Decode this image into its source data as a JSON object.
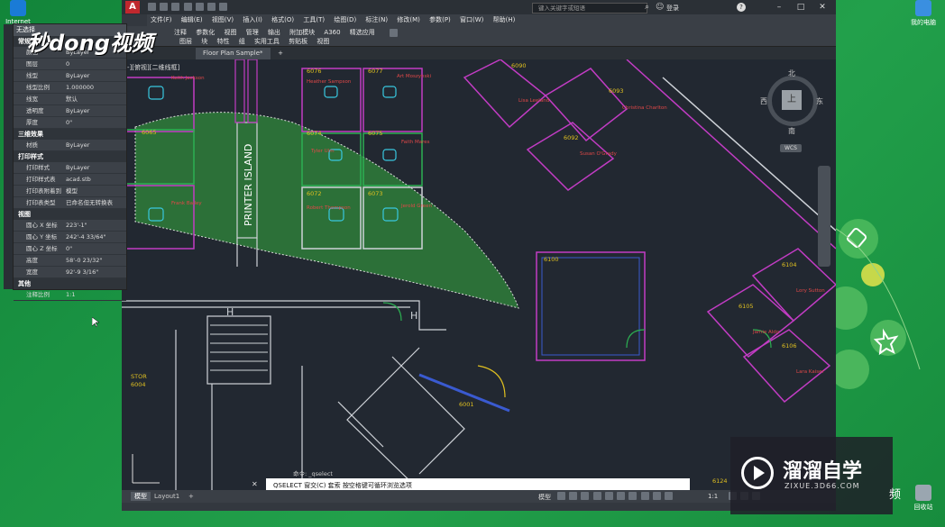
{
  "desktop": {
    "icons": [
      {
        "label": "Internet",
        "color": "#1a7bd6"
      },
      {
        "label": "我的电脑",
        "color": "#3a8fe0"
      },
      {
        "label": "回收站",
        "color": "#9aa6b0"
      }
    ]
  },
  "watermark": {
    "logo_text": "秒dong视频",
    "brand_cn": "溜溜自学",
    "brand_url": "ZIXUE.3D66.COM",
    "brand_fragment": "频"
  },
  "titlebar": {
    "search_placeholder": "键入关键字或短语",
    "login": "登录",
    "help": "?"
  },
  "menu": {
    "items": [
      "文件(F)",
      "编辑(E)",
      "视图(V)",
      "插入(I)",
      "格式(O)",
      "工具(T)",
      "绘图(D)",
      "标注(N)",
      "修改(M)",
      "参数(P)",
      "窗口(W)",
      "帮助(H)"
    ]
  },
  "ribbon": {
    "row1": [
      "注释",
      "参数化",
      "视图",
      "管理",
      "输出",
      "附加模块",
      "A360",
      "精选应用"
    ],
    "row2": [
      "图层",
      "块",
      "特性",
      "组",
      "实用工具",
      "剪贴板",
      "视图"
    ]
  },
  "tabs": {
    "doc": "Floor Plan Sample*",
    "add": "+"
  },
  "viewport": {
    "label": "-][俯视][二维线框]"
  },
  "properties": {
    "selection": "无选择",
    "sections": [
      {
        "title": "常规",
        "rows": [
          [
            "颜色",
            "ByLayer"
          ],
          [
            "图层",
            "0"
          ],
          [
            "线型",
            "ByLayer"
          ],
          [
            "线型比例",
            "1.000000"
          ],
          [
            "线宽",
            "默认"
          ],
          [
            "透明度",
            "ByLayer"
          ],
          [
            "厚度",
            "0\""
          ]
        ]
      },
      {
        "title": "三维效果",
        "rows": [
          [
            "材质",
            "ByLayer"
          ]
        ]
      },
      {
        "title": "打印样式",
        "rows": [
          [
            "打印样式",
            "ByLayer"
          ],
          [
            "打印样式表",
            "acad.stb"
          ],
          [
            "打印表附着到",
            "模型"
          ],
          [
            "打印表类型",
            "已命名但无转换表"
          ]
        ]
      },
      {
        "title": "视图",
        "rows": [
          [
            "圆心 X 坐标",
            "223'-1\""
          ],
          [
            "圆心 Y 坐标",
            "242'-4 33/64\""
          ],
          [
            "圆心 Z 坐标",
            "0\""
          ],
          [
            "高度",
            "58'-0 23/32\""
          ],
          [
            "宽度",
            "92'-9 3/16\""
          ]
        ]
      },
      {
        "title": "其他",
        "rows": [
          [
            "注释比例",
            "1:1"
          ]
        ]
      }
    ]
  },
  "viewcube": {
    "north": "北",
    "south": "南",
    "east": "东",
    "west": "西",
    "top": "上",
    "wcs": "WCS"
  },
  "drawing": {
    "printer_island": "PRINTER ISLAND",
    "rooms": [
      "6076",
      "6077",
      "6074",
      "6075",
      "6072",
      "6073",
      "6090",
      "6093",
      "6092",
      "6100",
      "6104",
      "6105",
      "6106",
      "6001",
      "6004",
      "6124",
      "6065"
    ],
    "names": [
      "Keith Jackson",
      "Heather Sampson",
      "Art Moszynski",
      "Tyler Ulm",
      "Faith Mares",
      "Robert Thompson",
      "Jerold Green",
      "Frank Bailey",
      "Lisa Leeland",
      "Christina Charlton",
      "Susan O'Grady",
      "Lory Sutton",
      "Jamie Aldo",
      "Lara Kaiser"
    ],
    "stor": "STOR",
    "h": "H"
  },
  "command": {
    "history": "命令: _qselect",
    "prompt": "QSELECT 窗交(C) 套索  按空格键可循环浏览选项"
  },
  "layouts": [
    "模型",
    "Layout1",
    "+"
  ],
  "status": {
    "model": "模型",
    "scale": "1:1"
  },
  "colors": {
    "cad_bg": "#222831",
    "wall_magenta": "#c23cc4",
    "desk_cyan": "#38c8e0",
    "label_yellow": "#e0c020",
    "name_red": "#e04848",
    "selection_fill": "#2e7d3a",
    "desktop_green": "#1c8a3a"
  }
}
